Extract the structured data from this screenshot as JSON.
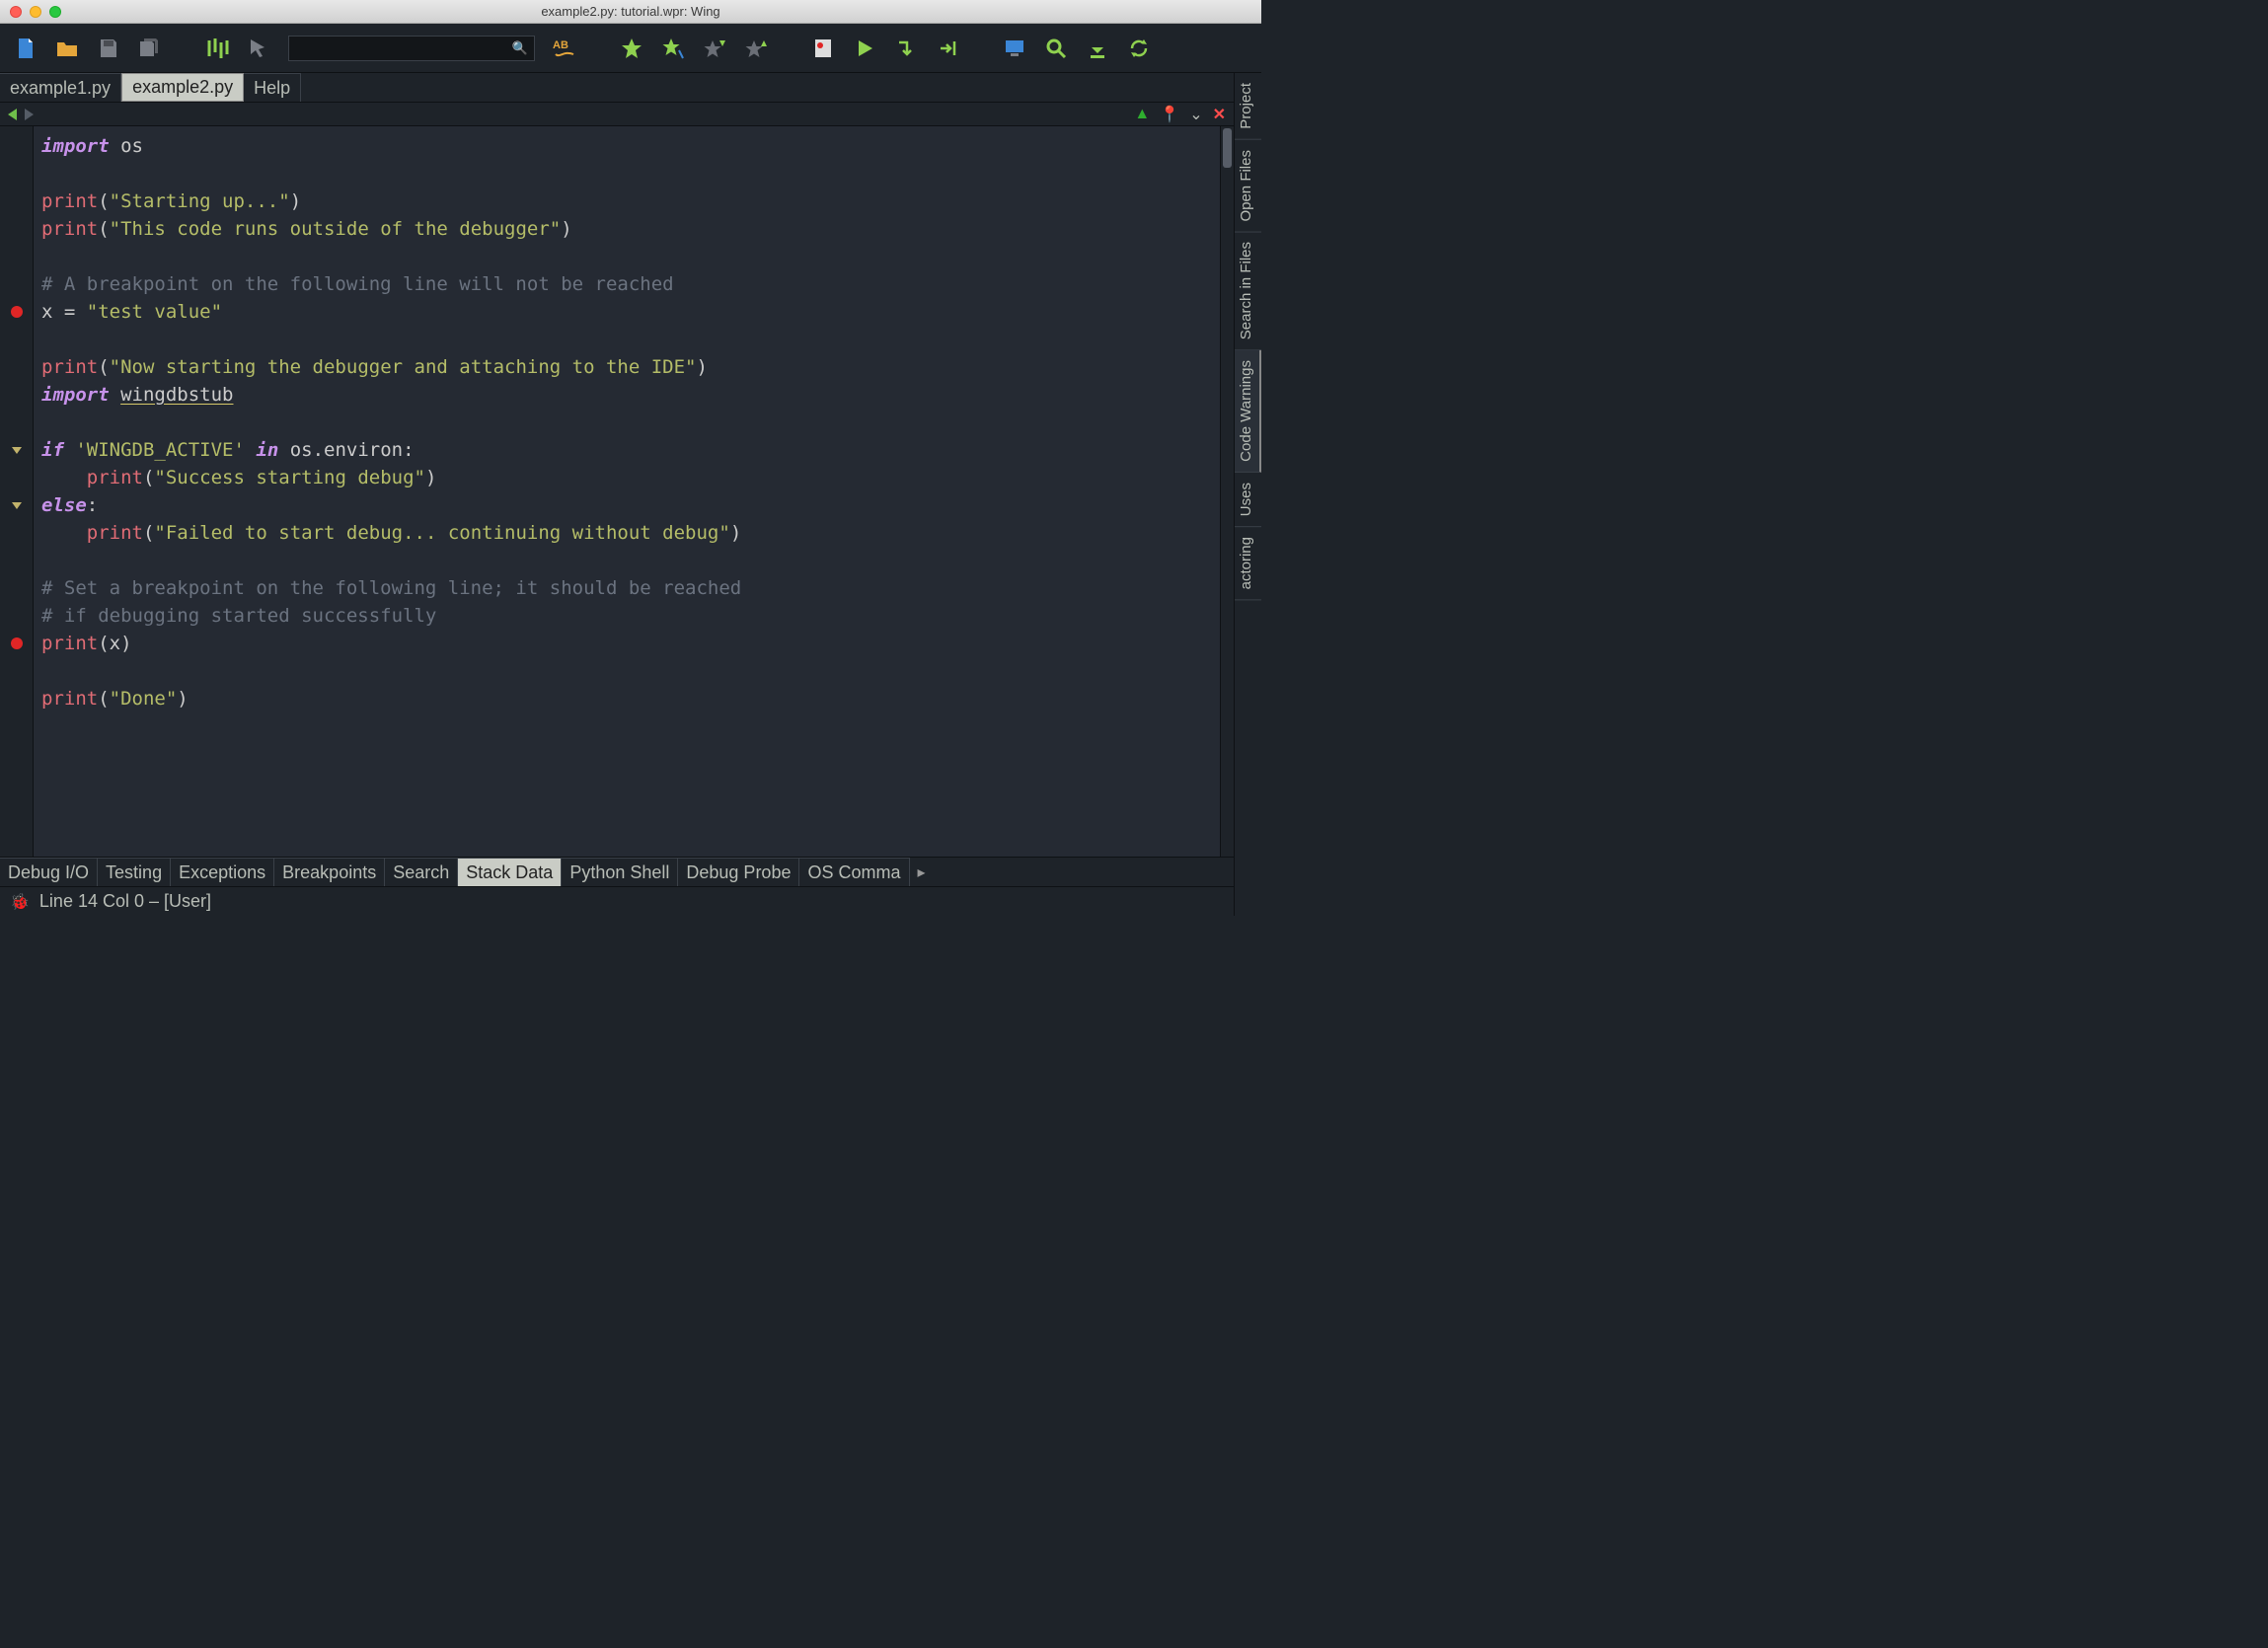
{
  "window": {
    "title": "example2.py: tutorial.wpr: Wing"
  },
  "file_tabs": [
    {
      "label": "example1.py",
      "active": false
    },
    {
      "label": "example2.py",
      "active": true
    },
    {
      "label": "Help",
      "active": false
    }
  ],
  "right_rail": [
    {
      "label": "Project",
      "active": false
    },
    {
      "label": "Open Files",
      "active": false
    },
    {
      "label": "Search in Files",
      "active": false
    },
    {
      "label": "Code Warnings",
      "active": true
    },
    {
      "label": "Uses",
      "active": false
    },
    {
      "label": "actoring",
      "active": false
    }
  ],
  "bottom_tabs": [
    {
      "label": "Debug I/O",
      "active": false
    },
    {
      "label": "Testing",
      "active": false
    },
    {
      "label": "Exceptions",
      "active": false
    },
    {
      "label": "Breakpoints",
      "active": false
    },
    {
      "label": "Search",
      "active": false
    },
    {
      "label": "Stack Data",
      "active": true
    },
    {
      "label": "Python Shell",
      "active": false
    },
    {
      "label": "Debug Probe",
      "active": false
    },
    {
      "label": "OS Comma",
      "active": false
    }
  ],
  "status": {
    "text": "Line 14 Col 0 – [User]"
  },
  "code_lines": [
    {
      "t": [
        [
          "kw",
          "import"
        ],
        [
          "id",
          " os"
        ]
      ]
    },
    {
      "t": []
    },
    {
      "t": [
        [
          "fn",
          "print"
        ],
        [
          "pun",
          "("
        ],
        [
          "str",
          "\"Starting up...\""
        ],
        [
          "pun",
          ")"
        ]
      ]
    },
    {
      "t": [
        [
          "fn",
          "print"
        ],
        [
          "pun",
          "("
        ],
        [
          "str",
          "\"This code runs outside of the debugger\""
        ],
        [
          "pun",
          ")"
        ]
      ]
    },
    {
      "t": []
    },
    {
      "t": [
        [
          "cmt",
          "# A breakpoint on the following line will not be reached"
        ]
      ]
    },
    {
      "t": [
        [
          "id",
          "x = "
        ],
        [
          "str",
          "\"test value\""
        ]
      ],
      "bp": true
    },
    {
      "t": []
    },
    {
      "t": [
        [
          "fn",
          "print"
        ],
        [
          "pun",
          "("
        ],
        [
          "str",
          "\"Now starting the debugger and attaching to the IDE\""
        ],
        [
          "pun",
          ")"
        ]
      ]
    },
    {
      "t": [
        [
          "kw",
          "import"
        ],
        [
          "id",
          " "
        ],
        [
          "mod",
          "wingdbstub"
        ]
      ]
    },
    {
      "t": []
    },
    {
      "t": [
        [
          "kw",
          "if"
        ],
        [
          "id",
          " "
        ],
        [
          "str",
          "'WINGDB_ACTIVE'"
        ],
        [
          "id",
          " "
        ],
        [
          "kw",
          "in"
        ],
        [
          "id",
          " os.environ:"
        ]
      ],
      "fold": true
    },
    {
      "t": [
        [
          "id",
          "    "
        ],
        [
          "fn",
          "print"
        ],
        [
          "pun",
          "("
        ],
        [
          "str",
          "\"Success starting debug\""
        ],
        [
          "pun",
          ")"
        ]
      ]
    },
    {
      "t": [
        [
          "kw",
          "else"
        ],
        [
          "pun",
          ":"
        ]
      ],
      "fold": true
    },
    {
      "t": [
        [
          "id",
          "    "
        ],
        [
          "fn",
          "print"
        ],
        [
          "pun",
          "("
        ],
        [
          "str",
          "\"Failed to start debug... continuing without debug\""
        ],
        [
          "pun",
          ")"
        ]
      ]
    },
    {
      "t": []
    },
    {
      "t": [
        [
          "cmt",
          "# Set a breakpoint on the following line; it should be reached"
        ]
      ]
    },
    {
      "t": [
        [
          "cmt",
          "# if debugging started successfully"
        ]
      ]
    },
    {
      "t": [
        [
          "fn",
          "print"
        ],
        [
          "pun",
          "(x)"
        ]
      ],
      "bp": true
    },
    {
      "t": []
    },
    {
      "t": [
        [
          "fn",
          "print"
        ],
        [
          "pun",
          "("
        ],
        [
          "str",
          "\"Done\""
        ],
        [
          "pun",
          ")"
        ]
      ]
    }
  ],
  "toolbar_icons": [
    "new-file-icon",
    "open-folder-icon",
    "save-icon",
    "save-all-icon",
    "indent-icon",
    "cursor-icon",
    "search-field",
    "spellcheck-icon",
    "bookmark-icon",
    "bookmark-add-icon",
    "bookmark-up-icon",
    "bookmark-down-icon",
    "breakpoint-icon",
    "run-icon",
    "step-over-icon",
    "step-into-icon",
    "monitor-icon",
    "search-icon",
    "download-icon",
    "refresh-icon"
  ],
  "colors": {
    "green": "#8fd14f",
    "orange": "#e5a63b",
    "red": "#e55",
    "blue": "#3b7ddd"
  }
}
